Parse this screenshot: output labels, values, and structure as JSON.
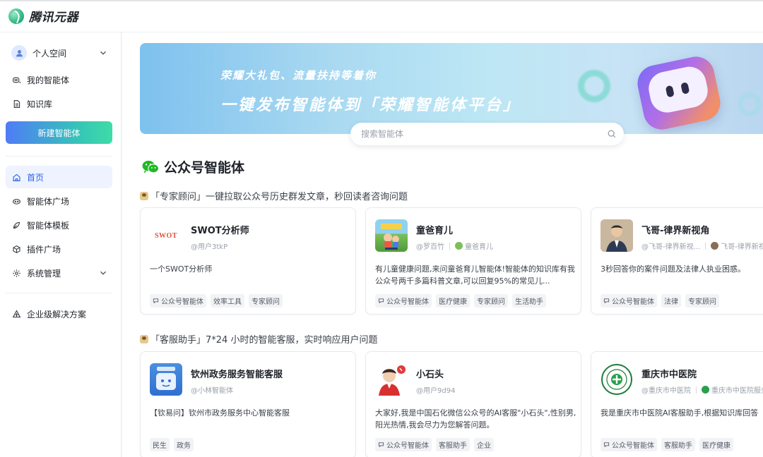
{
  "brand": {
    "name": "腾讯元器"
  },
  "sidebar": {
    "workspace": {
      "label": "个人空间"
    },
    "items": [
      {
        "label": "我的智能体",
        "icon": "agent-icon"
      },
      {
        "label": "知识库",
        "icon": "document-icon"
      }
    ],
    "new_button": "新建智能体",
    "nav": [
      {
        "label": "首页",
        "icon": "home-icon",
        "active": true
      },
      {
        "label": "智能体广场",
        "icon": "plaza-icon"
      },
      {
        "label": "智能体模板",
        "icon": "template-icon"
      },
      {
        "label": "插件广场",
        "icon": "plugin-icon"
      },
      {
        "label": "系统管理",
        "icon": "settings-icon"
      }
    ],
    "enterprise": {
      "label": "企业级解决方案",
      "icon": "enterprise-icon"
    }
  },
  "banner": {
    "subtitle": "荣耀大礼包、流量扶持等着你",
    "headline": "一键发布智能体到「荣耀智能体平台」"
  },
  "search": {
    "placeholder": "搜索智能体"
  },
  "section": {
    "title": "公众号智能体"
  },
  "groups": [
    {
      "heading": "「专家顾问」一键拉取公众号历史群发文章，秒回读者咨询问题",
      "cards": [
        {
          "name": "SWOT分析师",
          "author": "@用户3tkP",
          "source": "",
          "description": "一个SWOT分析师",
          "tags": [
            "公众号智能体",
            "效率工具",
            "专家顾问"
          ],
          "thumb_text": "SWOT"
        },
        {
          "name": "童爸育儿",
          "author": "@罗百竹",
          "source": "童爸育儿",
          "description": "有儿童健康问题,来问童爸育儿智能体!智能体的知识库有我公众号两千多篇科普文章,可以回复95%的常见儿...",
          "tags": [
            "公众号智能体",
            "医疗健康",
            "专家顾问",
            "生活助手"
          ],
          "thumb_text": ""
        },
        {
          "name": "飞哥-律界新视角",
          "author": "@飞哥-律界新视...",
          "source": "飞哥-律界新视",
          "description": "3秒回答你的案件问题及法律人执业困惑。",
          "tags": [
            "公众号智能体",
            "法律",
            "专家顾问"
          ],
          "thumb_text": ""
        }
      ]
    },
    {
      "heading": "「客服助手」7*24 小时的智能客服，实时响应用户问题",
      "cards": [
        {
          "name": "钦州政务服务智能客服",
          "author": "@小林智能体",
          "source": "",
          "description": "【钦易问】钦州市政务服务中心智能客服",
          "tags": [
            "民生",
            "政务"
          ],
          "thumb_text": ""
        },
        {
          "name": "小石头",
          "author": "@用户9d94",
          "source": "",
          "description": "大家好,我是中国石化微信公众号的AI客服\"小石头\",性别男,阳光热情,我会尽力为您解答问题。",
          "tags": [
            "公众号智能体",
            "客服助手",
            "企业"
          ],
          "thumb_text": ""
        },
        {
          "name": "重庆市中医院",
          "author": "@重庆市中医院",
          "source": "重庆市中医院服务",
          "description": "我是重庆市中医院AI客服助手,根据知识库回答",
          "tags": [
            "公众号智能体",
            "客服助手",
            "医疗健康"
          ],
          "thumb_text": ""
        }
      ]
    }
  ],
  "colors": {
    "accent": "#2f63e6",
    "active_bg": "#eef3ff",
    "wechat_green": "#1fb922"
  }
}
